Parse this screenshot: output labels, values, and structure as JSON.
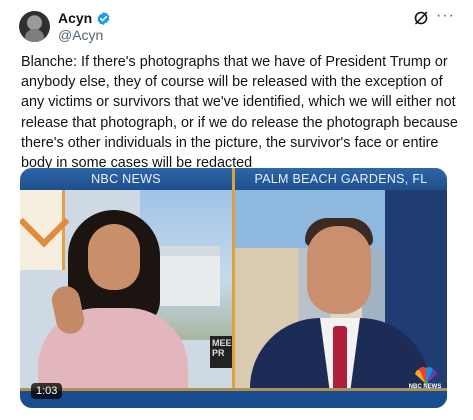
{
  "tweet": {
    "display_name": "Acyn",
    "handle": "@Acyn",
    "verified": true,
    "verified_color": "#1d9bf0",
    "text": "Blanche: If there's photographs that we have of President Trump or anybody else, they of course will be released with the exception of any victims or survivors that we've identified, which we will either not release that photograph, or if we do release the photograph because there's other individuals in the picture, the survivor's face or entire body in some cases will be redacted"
  },
  "header_icons": [
    "grok-icon",
    "more-icon"
  ],
  "video": {
    "left_banner": "NBC NEWS",
    "right_banner": "PALM BEACH GARDENS, FL",
    "duration": "1:03",
    "screen_label": "MEE PR",
    "network_logo_text": "NBC NEWS",
    "banner_color": "#2e66a8",
    "accent_color": "#d7a33a"
  }
}
